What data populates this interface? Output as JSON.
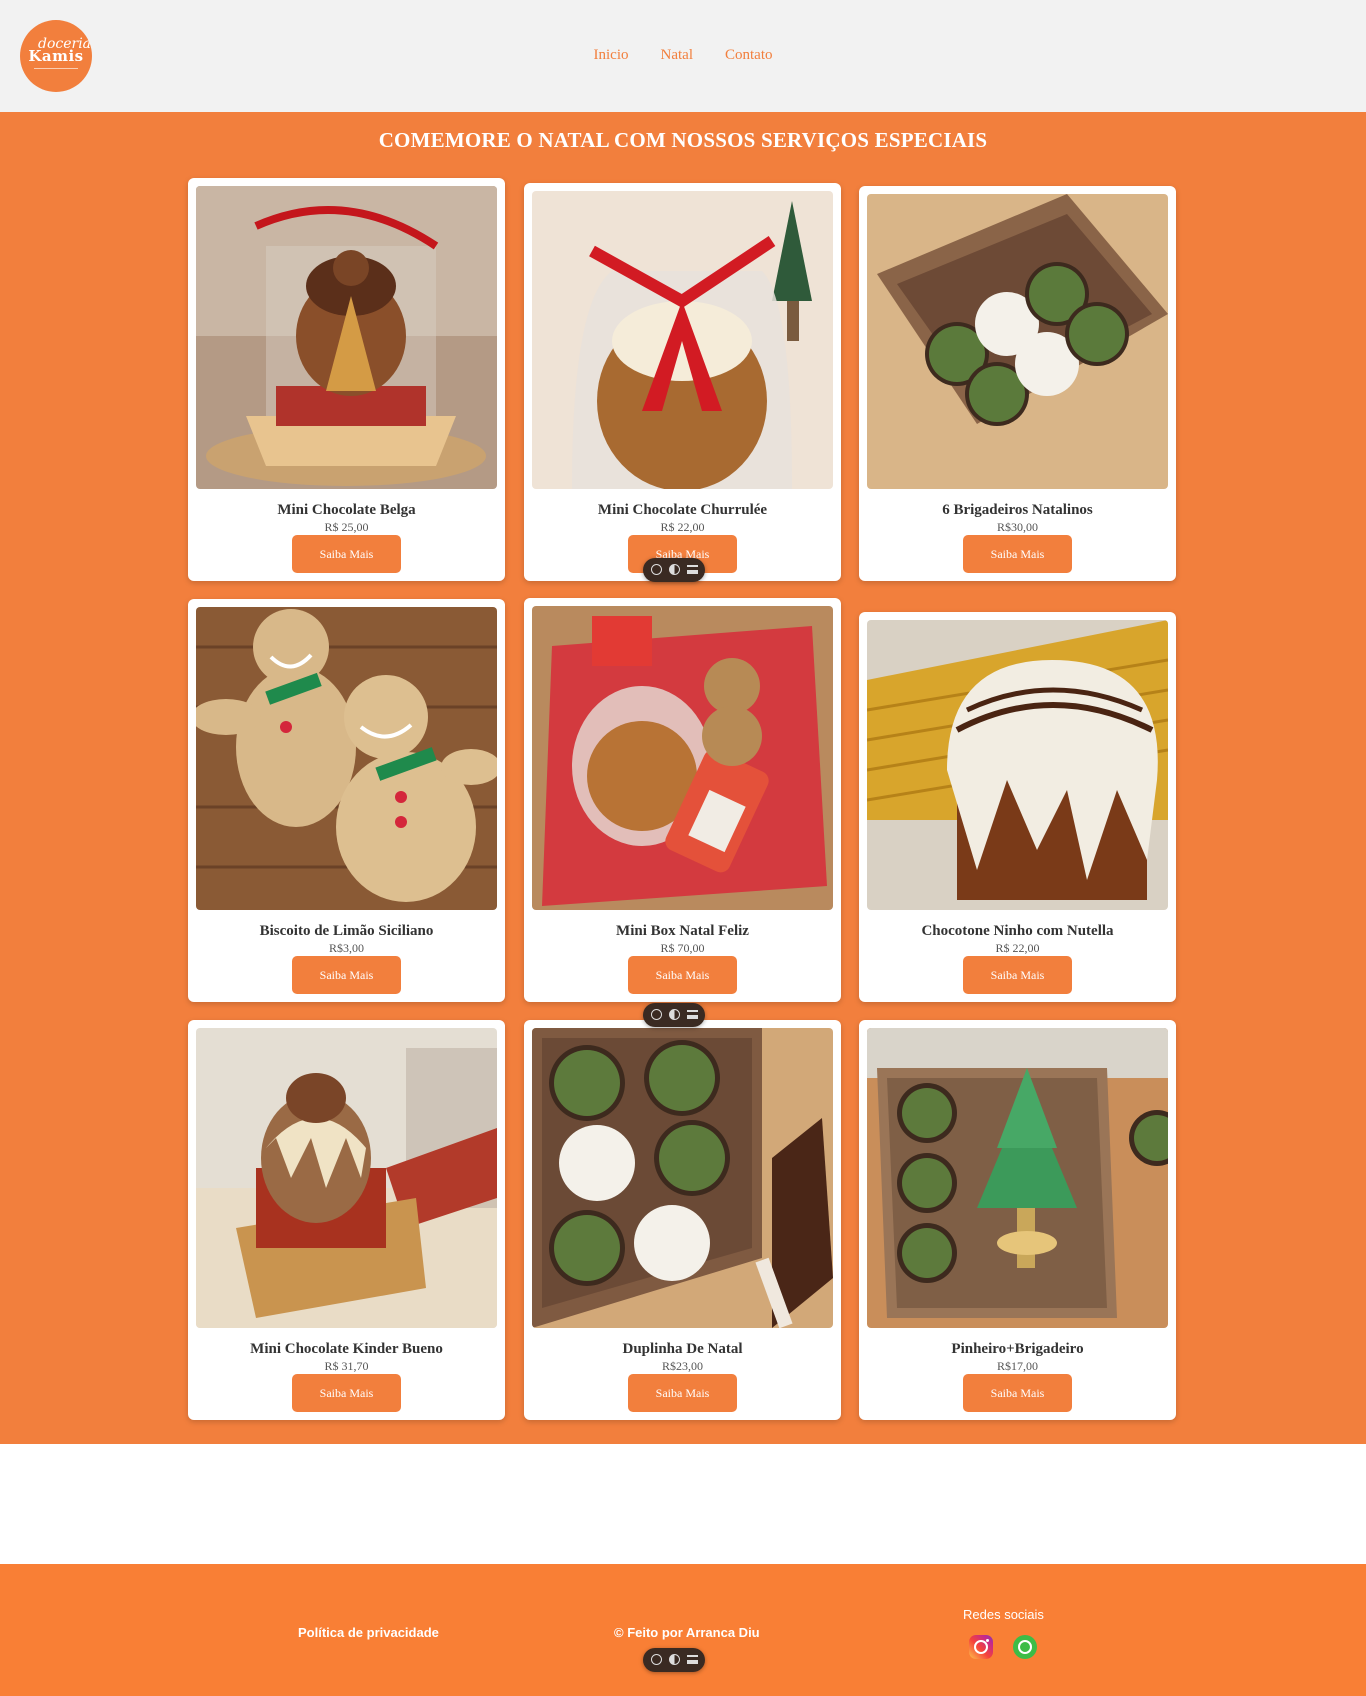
{
  "header": {
    "logo": {
      "line1": "doceria",
      "line2": "Kamis"
    },
    "nav": [
      "Inicio",
      "Natal",
      "Contato"
    ]
  },
  "main": {
    "title": "COMEMORE O NATAL COM NOSSOS SERVIÇOS ESPECIAIS",
    "button_label": "Saiba Mais",
    "products": [
      {
        "name": "Mini Chocolate Belga",
        "price": "R$ 25,00",
        "image": "mini-panettone-chocolate-photo"
      },
      {
        "name": "Mini Chocolate Churrulée",
        "price": "R$ 22,00",
        "image": "wrapped-panettone-red-ribbon-photo"
      },
      {
        "name": "6 Brigadeiros Natalinos",
        "price": "R$30,00",
        "image": "brigadeiros-box-photo"
      },
      {
        "name": "Biscoito de Limão Siciliano",
        "price": "R$3,00",
        "image": "gingerbread-cookies-photo"
      },
      {
        "name": "Mini Box Natal Feliz",
        "price": "R$ 70,00",
        "image": "christmas-gift-box-photo"
      },
      {
        "name": "Chocotone Ninho com Nutella",
        "price": "R$ 22,00",
        "image": "chocotone-drizzle-photo"
      },
      {
        "name": "Mini Chocolate Kinder Bueno",
        "price": "R$ 31,70",
        "image": "mini-panettone-kinder-photo"
      },
      {
        "name": "Duplinha De Natal",
        "price": "R$23,00",
        "image": "brigadeiros-duo-photo"
      },
      {
        "name": "Pinheiro+Brigadeiro",
        "price": "R$17,00",
        "image": "tree-cookie-brigadeiro-photo"
      }
    ]
  },
  "footer": {
    "privacy": "Política de privacidade",
    "made_by": "© Feito por Arranca Diu",
    "social_title": "Redes sociais",
    "icons": [
      "instagram-icon",
      "whatsapp-icon"
    ]
  },
  "colors": {
    "accent": "#f27f3d",
    "footer": "#f97f35",
    "header_bg": "#f2f2f2"
  }
}
